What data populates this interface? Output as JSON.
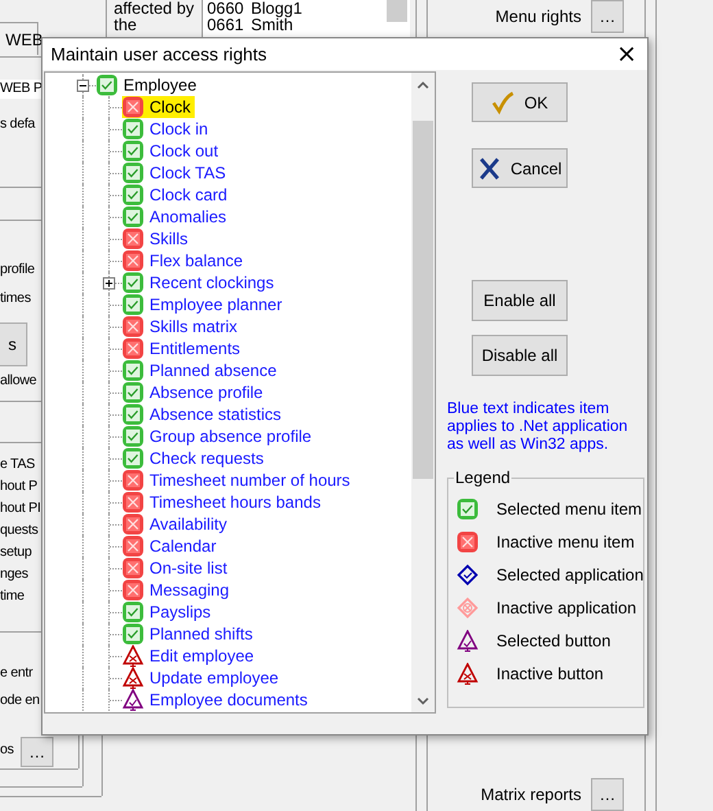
{
  "background_window": {
    "tab": "WEB",
    "description_lines": [
      "affected by",
      "the"
    ],
    "employee_list": [
      {
        "code": "0660",
        "name": "Blogg1"
      },
      {
        "code": "0661",
        "name": "Smith"
      }
    ],
    "left_items": [
      {
        "kind": "field",
        "text": "WEB P"
      },
      {
        "kind": "label",
        "text": "s defa"
      },
      {
        "kind": "label",
        "text": "profile"
      },
      {
        "kind": "label",
        "text": "times"
      },
      {
        "kind": "button",
        "text": "s"
      },
      {
        "kind": "label",
        "text": "allowe"
      },
      {
        "kind": "label",
        "text": "e TAS"
      },
      {
        "kind": "label",
        "text": "hout P"
      },
      {
        "kind": "label",
        "text": "hout PI"
      },
      {
        "kind": "label",
        "text": "quests"
      },
      {
        "kind": "label",
        "text": "setup"
      },
      {
        "kind": "label",
        "text": "nges"
      },
      {
        "kind": "label",
        "text": "time"
      },
      {
        "kind": "label",
        "text": "e entr"
      },
      {
        "kind": "label",
        "text": "ode en"
      },
      {
        "kind": "label",
        "text": "os"
      },
      {
        "kind": "button",
        "text": "…"
      }
    ],
    "menu_rights": {
      "label": "Menu rights",
      "button": "…"
    },
    "matrix_reports": {
      "label": "Matrix reports",
      "button": "…"
    }
  },
  "dialog": {
    "title": "Maintain user access rights",
    "close": "×",
    "tree": [
      {
        "label": "Employee",
        "kind": "selected_menu",
        "net": false,
        "selected": false,
        "expanded": true,
        "children": [
          {
            "label": "Clock",
            "kind": "inactive_menu",
            "net": false,
            "selected": true
          },
          {
            "label": "Clock in",
            "kind": "selected_menu",
            "net": true,
            "selected": false
          },
          {
            "label": "Clock out",
            "kind": "selected_menu",
            "net": true,
            "selected": false
          },
          {
            "label": "Clock TAS",
            "kind": "selected_menu",
            "net": true,
            "selected": false
          },
          {
            "label": "Clock card",
            "kind": "selected_menu",
            "net": true,
            "selected": false
          },
          {
            "label": "Anomalies",
            "kind": "selected_menu",
            "net": true,
            "selected": false
          },
          {
            "label": "Skills",
            "kind": "inactive_menu",
            "net": true,
            "selected": false
          },
          {
            "label": "Flex balance",
            "kind": "inactive_menu",
            "net": true,
            "selected": false
          },
          {
            "label": "Recent clockings",
            "kind": "selected_menu",
            "net": true,
            "selected": false,
            "expanded": false
          },
          {
            "label": "Employee planner",
            "kind": "selected_menu",
            "net": true,
            "selected": false
          },
          {
            "label": "Skills matrix",
            "kind": "inactive_menu",
            "net": true,
            "selected": false
          },
          {
            "label": "Entitlements",
            "kind": "inactive_menu",
            "net": true,
            "selected": false
          },
          {
            "label": "Planned absence",
            "kind": "selected_menu",
            "net": true,
            "selected": false
          },
          {
            "label": "Absence profile",
            "kind": "selected_menu",
            "net": true,
            "selected": false
          },
          {
            "label": "Absence statistics",
            "kind": "selected_menu",
            "net": true,
            "selected": false
          },
          {
            "label": "Group absence profile",
            "kind": "selected_menu",
            "net": true,
            "selected": false
          },
          {
            "label": "Check requests",
            "kind": "selected_menu",
            "net": true,
            "selected": false
          },
          {
            "label": "Timesheet number of hours",
            "kind": "inactive_menu",
            "net": true,
            "selected": false
          },
          {
            "label": "Timesheet hours bands",
            "kind": "inactive_menu",
            "net": true,
            "selected": false
          },
          {
            "label": "Availability",
            "kind": "inactive_menu",
            "net": true,
            "selected": false
          },
          {
            "label": "Calendar",
            "kind": "inactive_menu",
            "net": true,
            "selected": false
          },
          {
            "label": "On-site list",
            "kind": "inactive_menu",
            "net": true,
            "selected": false
          },
          {
            "label": "Messaging",
            "kind": "inactive_menu",
            "net": true,
            "selected": false
          },
          {
            "label": "Payslips",
            "kind": "selected_menu",
            "net": true,
            "selected": false
          },
          {
            "label": "Planned shifts",
            "kind": "selected_menu",
            "net": true,
            "selected": false
          },
          {
            "label": "Edit employee",
            "kind": "inactive_button",
            "net": true,
            "selected": false
          },
          {
            "label": "Update employee",
            "kind": "inactive_button",
            "net": true,
            "selected": false
          },
          {
            "label": "Employee documents",
            "kind": "selected_button",
            "net": true,
            "selected": false
          }
        ]
      }
    ],
    "buttons": [
      {
        "kind": "ok",
        "label": "OK"
      },
      {
        "kind": "cancel",
        "label": "Cancel"
      },
      {
        "kind": "enable",
        "label": "Enable all"
      },
      {
        "kind": "disable",
        "label": "Disable all"
      }
    ],
    "note": "Blue text indicates item applies to .Net application as well as Win32 apps.",
    "legend": {
      "title": "Legend",
      "items": [
        {
          "kind": "selected_menu",
          "label": "Selected menu item"
        },
        {
          "kind": "inactive_menu",
          "label": "Inactive menu item"
        },
        {
          "kind": "selected_app",
          "label": "Selected application"
        },
        {
          "kind": "inactive_app",
          "label": "Inactive application"
        },
        {
          "kind": "selected_button",
          "label": "Selected button"
        },
        {
          "kind": "inactive_button",
          "label": "Inactive button"
        }
      ]
    }
  }
}
